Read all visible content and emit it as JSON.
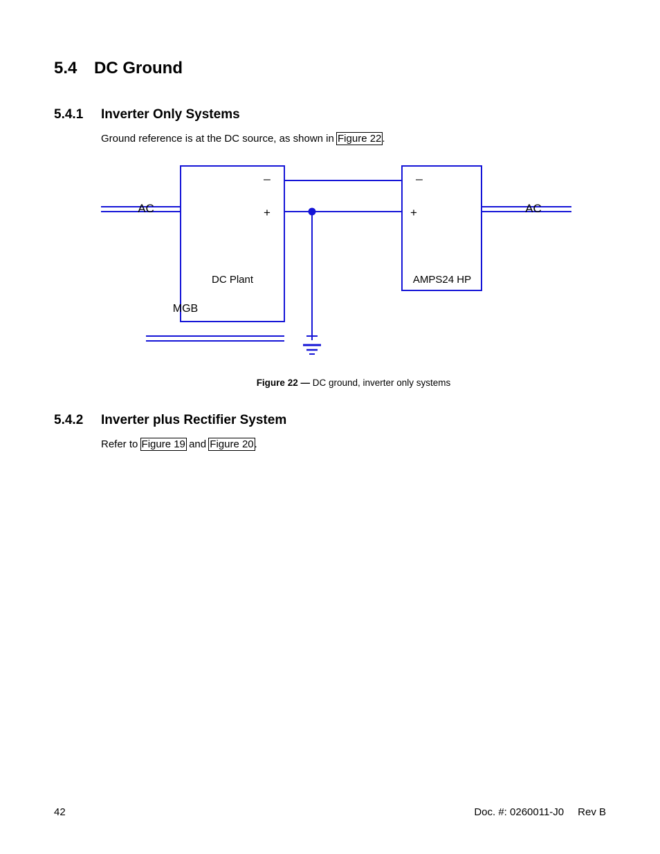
{
  "section": {
    "number": "5.4",
    "title": "DC Ground"
  },
  "sub1": {
    "number": "5.4.1",
    "title": "Inverter Only Systems",
    "body_prefix": "Ground reference is at the DC source, as shown in ",
    "link": "Figure 22",
    "body_suffix": "."
  },
  "figure": {
    "ac_left": "AC",
    "ac_right": "AC",
    "minus": "_",
    "plus": "+",
    "dc_plant": "DC Plant",
    "amps": "AMPS24 HP",
    "mgb": "MGB",
    "caption_label": "Figure 22  —",
    "caption_text": "  DC ground, inverter only systems"
  },
  "sub2": {
    "number": "5.4.2",
    "title": "Inverter plus Rectifier System",
    "body_prefix": "Refer to ",
    "link1": "Figure 19",
    "body_mid": " and ",
    "link2": "Figure 20",
    "body_suffix": "."
  },
  "footer": {
    "page": "42",
    "doc": "Doc. #: 0260011-J0",
    "rev": "Rev B"
  }
}
